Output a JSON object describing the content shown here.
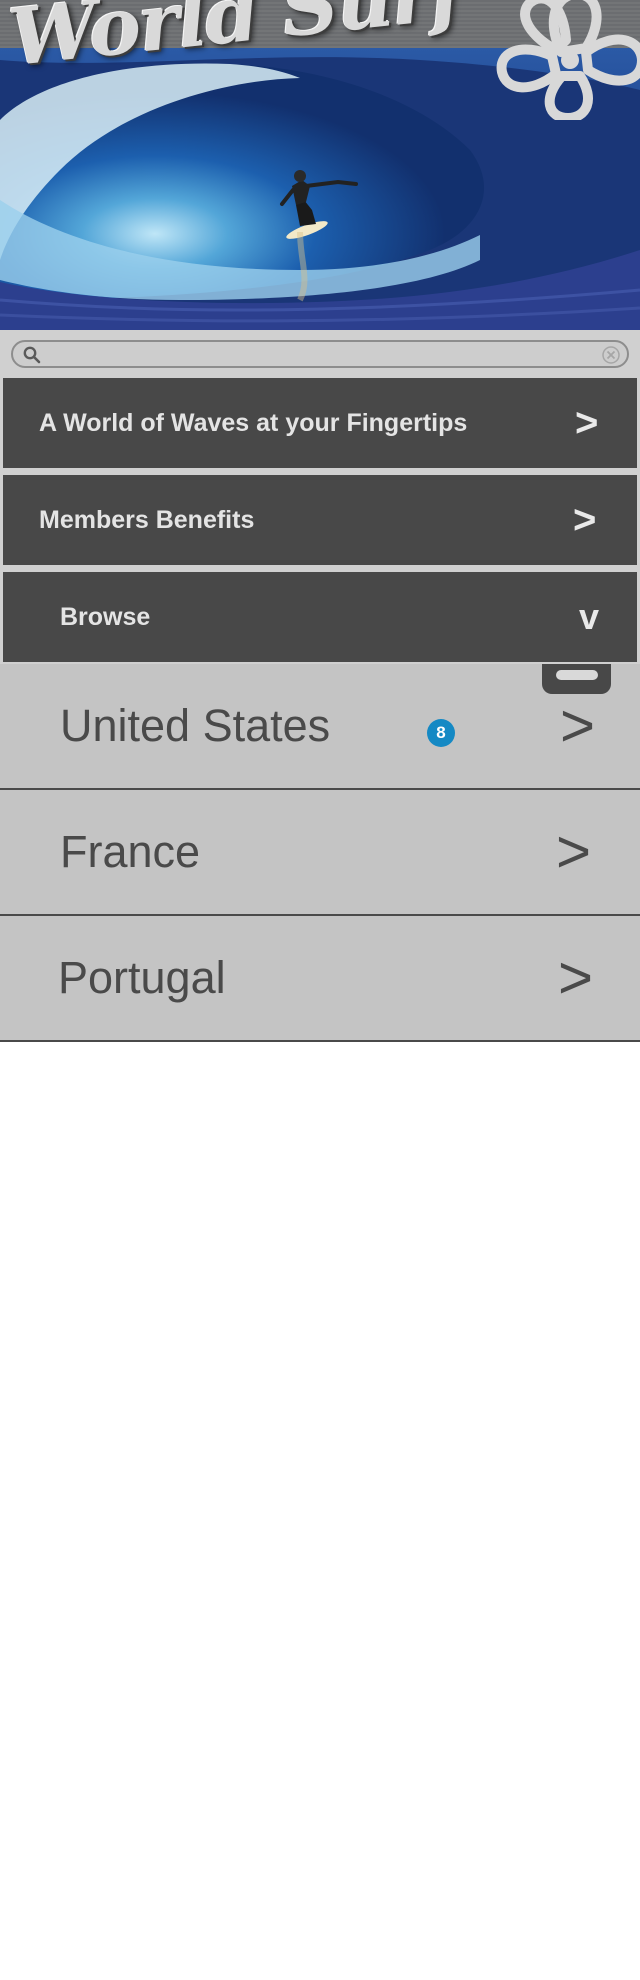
{
  "header": {
    "logo_text": "World Surf"
  },
  "search": {
    "placeholder": "",
    "value": ""
  },
  "menu": {
    "items": [
      {
        "label": "A World of Waves at your Fingertips",
        "chevron": ">"
      },
      {
        "label": "Members Benefits",
        "chevron": ">"
      },
      {
        "label": "Browse",
        "chevron": "v"
      }
    ]
  },
  "countries": [
    {
      "name": "United States",
      "chevron": ">",
      "badge": "8"
    },
    {
      "name": "France",
      "chevron": ">"
    },
    {
      "name": "Portugal",
      "chevron": ">"
    }
  ],
  "colors": {
    "menu_background": "#484848",
    "list_background": "#c4c4c4",
    "badge": "#1589c4",
    "page_background": "#ffffff"
  },
  "icons": [
    "hibiscus-flower-icon",
    "search-icon",
    "clear-icon",
    "chevron-right-icon",
    "chevron-down-icon"
  ]
}
